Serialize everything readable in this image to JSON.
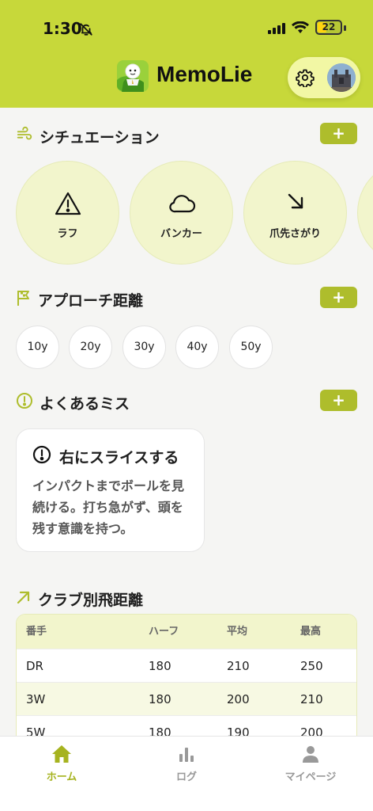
{
  "status_bar": {
    "time": "1:30",
    "battery": "22"
  },
  "header": {
    "app_title": "MemoLie"
  },
  "sections": {
    "situation": {
      "title": "シチュエーション",
      "add_label": "+"
    },
    "approach": {
      "title": "アプローチ距離",
      "add_label": "+"
    },
    "miss": {
      "title": "よくあるミス",
      "add_label": "+"
    },
    "club": {
      "title": "クラブ別飛距離"
    }
  },
  "situations": [
    {
      "label": "ラフ",
      "icon": "warning-icon"
    },
    {
      "label": "バンカー",
      "icon": "cloud-icon"
    },
    {
      "label": "爪先さがり",
      "icon": "arrow-down-right-icon"
    }
  ],
  "distances": [
    "10y",
    "20y",
    "30y",
    "40y",
    "50y"
  ],
  "miss_card": {
    "title": "右にスライスする",
    "body": "インパクトまでボールを見続ける。打ち急がず、頭を残す意識を持つ。"
  },
  "club_table": {
    "headers": [
      "番手",
      "ハーフ",
      "平均",
      "最高"
    ],
    "rows": [
      [
        "DR",
        "180",
        "210",
        "250"
      ],
      [
        "3W",
        "180",
        "200",
        "210"
      ],
      [
        "5W",
        "180",
        "190",
        "200"
      ]
    ]
  },
  "bottom_nav": [
    {
      "label": "ホーム",
      "active": true
    },
    {
      "label": "ログ",
      "active": false
    },
    {
      "label": "マイページ",
      "active": false
    }
  ],
  "colors": {
    "accent": "#c7d83a",
    "button": "#aebd2c",
    "card_tint": "#f2f5cc"
  }
}
